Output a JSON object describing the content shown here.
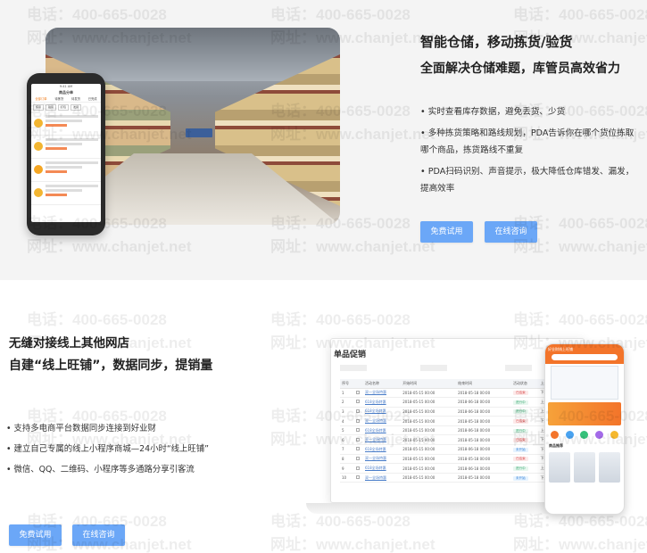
{
  "watermark": {
    "phone": "电话：400-665-0028",
    "site": "网址：www.chanjet.net"
  },
  "section1": {
    "title": "智能仓储，移动拣货/验货",
    "subtitle": "全面解决仓储难题，库管员高效省力",
    "bullets": [
      "• 实时查看库存数据，避免丢货、少货",
      "• 多种拣货策略和路线规划，PDA告诉你在哪个货位拣取哪个商品，拣货路线不重复",
      "• PDA扫码识别、声音提示，极大降低仓库错发、漏发，提高效率"
    ],
    "trial_button": "免费试用",
    "consult_button": "在线咨询",
    "phone_mock": {
      "status": "9:41 AM",
      "title": "商品分单",
      "tabs": [
        "全部订单",
        "待拣货",
        "待发货",
        "已完成"
      ],
      "chips": [
        "拣货",
        "验货",
        "打包",
        "发货"
      ]
    }
  },
  "section2": {
    "title": "无缝对接线上其他网店",
    "subtitle": "自建“线上旺铺”，数据同步，提销量",
    "bullets": [
      "• 支持多电商平台数据同步连接到好业财",
      "• 建立自己专属的线上小程序商城—24小时“线上旺铺”",
      "• 微信、QQ、二维码、小程序等多通路分享引客流"
    ],
    "trial_button": "免费试用",
    "consult_button": "在线咨询",
    "laptop_mock": {
      "title": "单品促销",
      "headers": [
        "序号",
        "",
        "活动名称",
        "开始时间",
        "结束时间",
        "活动状态",
        "上架状态",
        "操作"
      ],
      "rows": [
        [
          "1",
          "",
          "双一全场特惠",
          "2018-05-15 00:00",
          "2018-05-18 00:00",
          "已结束",
          "下架",
          "编辑"
        ],
        [
          "2",
          "",
          "618全场特惠",
          "2018-05-15 00:00",
          "2018-06-18 00:00",
          "进行中",
          "上架",
          "编辑"
        ],
        [
          "3",
          "",
          "618全场特惠",
          "2018-05-15 00:00",
          "2018-06-18 00:00",
          "进行中",
          "上架",
          "编辑"
        ],
        [
          "4",
          "",
          "双一全场特惠",
          "2018-05-15 00:00",
          "2018-05-18 00:00",
          "已结束",
          "下架",
          "编辑"
        ],
        [
          "5",
          "",
          "618全场特惠",
          "2018-05-15 00:00",
          "2018-06-18 00:00",
          "进行中",
          "上架",
          "编辑"
        ],
        [
          "6",
          "",
          "双一全场特惠",
          "2018-05-15 00:00",
          "2018-05-18 00:00",
          "已结束",
          "下架",
          "编辑"
        ],
        [
          "7",
          "",
          "618全场特惠",
          "2018-05-15 00:00",
          "2018-06-18 00:00",
          "未开始",
          "下架",
          "编辑"
        ],
        [
          "8",
          "",
          "双一全场特惠",
          "2018-05-15 00:00",
          "2018-05-18 00:00",
          "已结束",
          "下架",
          "编辑"
        ],
        [
          "9",
          "",
          "618全场特惠",
          "2018-05-15 00:00",
          "2018-06-18 00:00",
          "进行中",
          "上架",
          "编辑"
        ],
        [
          "10",
          "",
          "双一全场特惠",
          "2018-05-15 00:00",
          "2018-05-18 00:00",
          "未开始",
          "下架",
          "编辑"
        ]
      ]
    },
    "phone_mock": {
      "header": "好业财线上旺铺",
      "section_label": "商品推荐"
    }
  },
  "colors": {
    "button": "#6ba7f7",
    "section1_bg": "#f4f4f4",
    "mall_orange": "#f3742a"
  }
}
